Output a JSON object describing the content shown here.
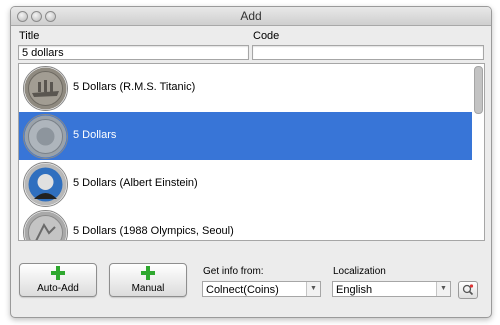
{
  "window": {
    "title": "Add"
  },
  "form": {
    "title_label": "Title",
    "title_value": "5 dollars",
    "code_label": "Code",
    "code_value": ""
  },
  "results": [
    {
      "name": "5 Dollars (R.M.S. Titanic)",
      "selected": false
    },
    {
      "name": "5 Dollars",
      "selected": true
    },
    {
      "name": "5 Dollars (Albert Einstein)",
      "selected": false
    },
    {
      "name": "5 Dollars (1988 Olympics, Seoul)",
      "selected": false
    }
  ],
  "buttons": {
    "auto_add": "Auto-Add",
    "manual": "Manual"
  },
  "get_info": {
    "label": "Get info from:",
    "value": "Colnect(Coins)"
  },
  "localization": {
    "label": "Localization",
    "value": "English"
  },
  "colors": {
    "selection": "#3875d7",
    "plus": "#2fa82f"
  }
}
